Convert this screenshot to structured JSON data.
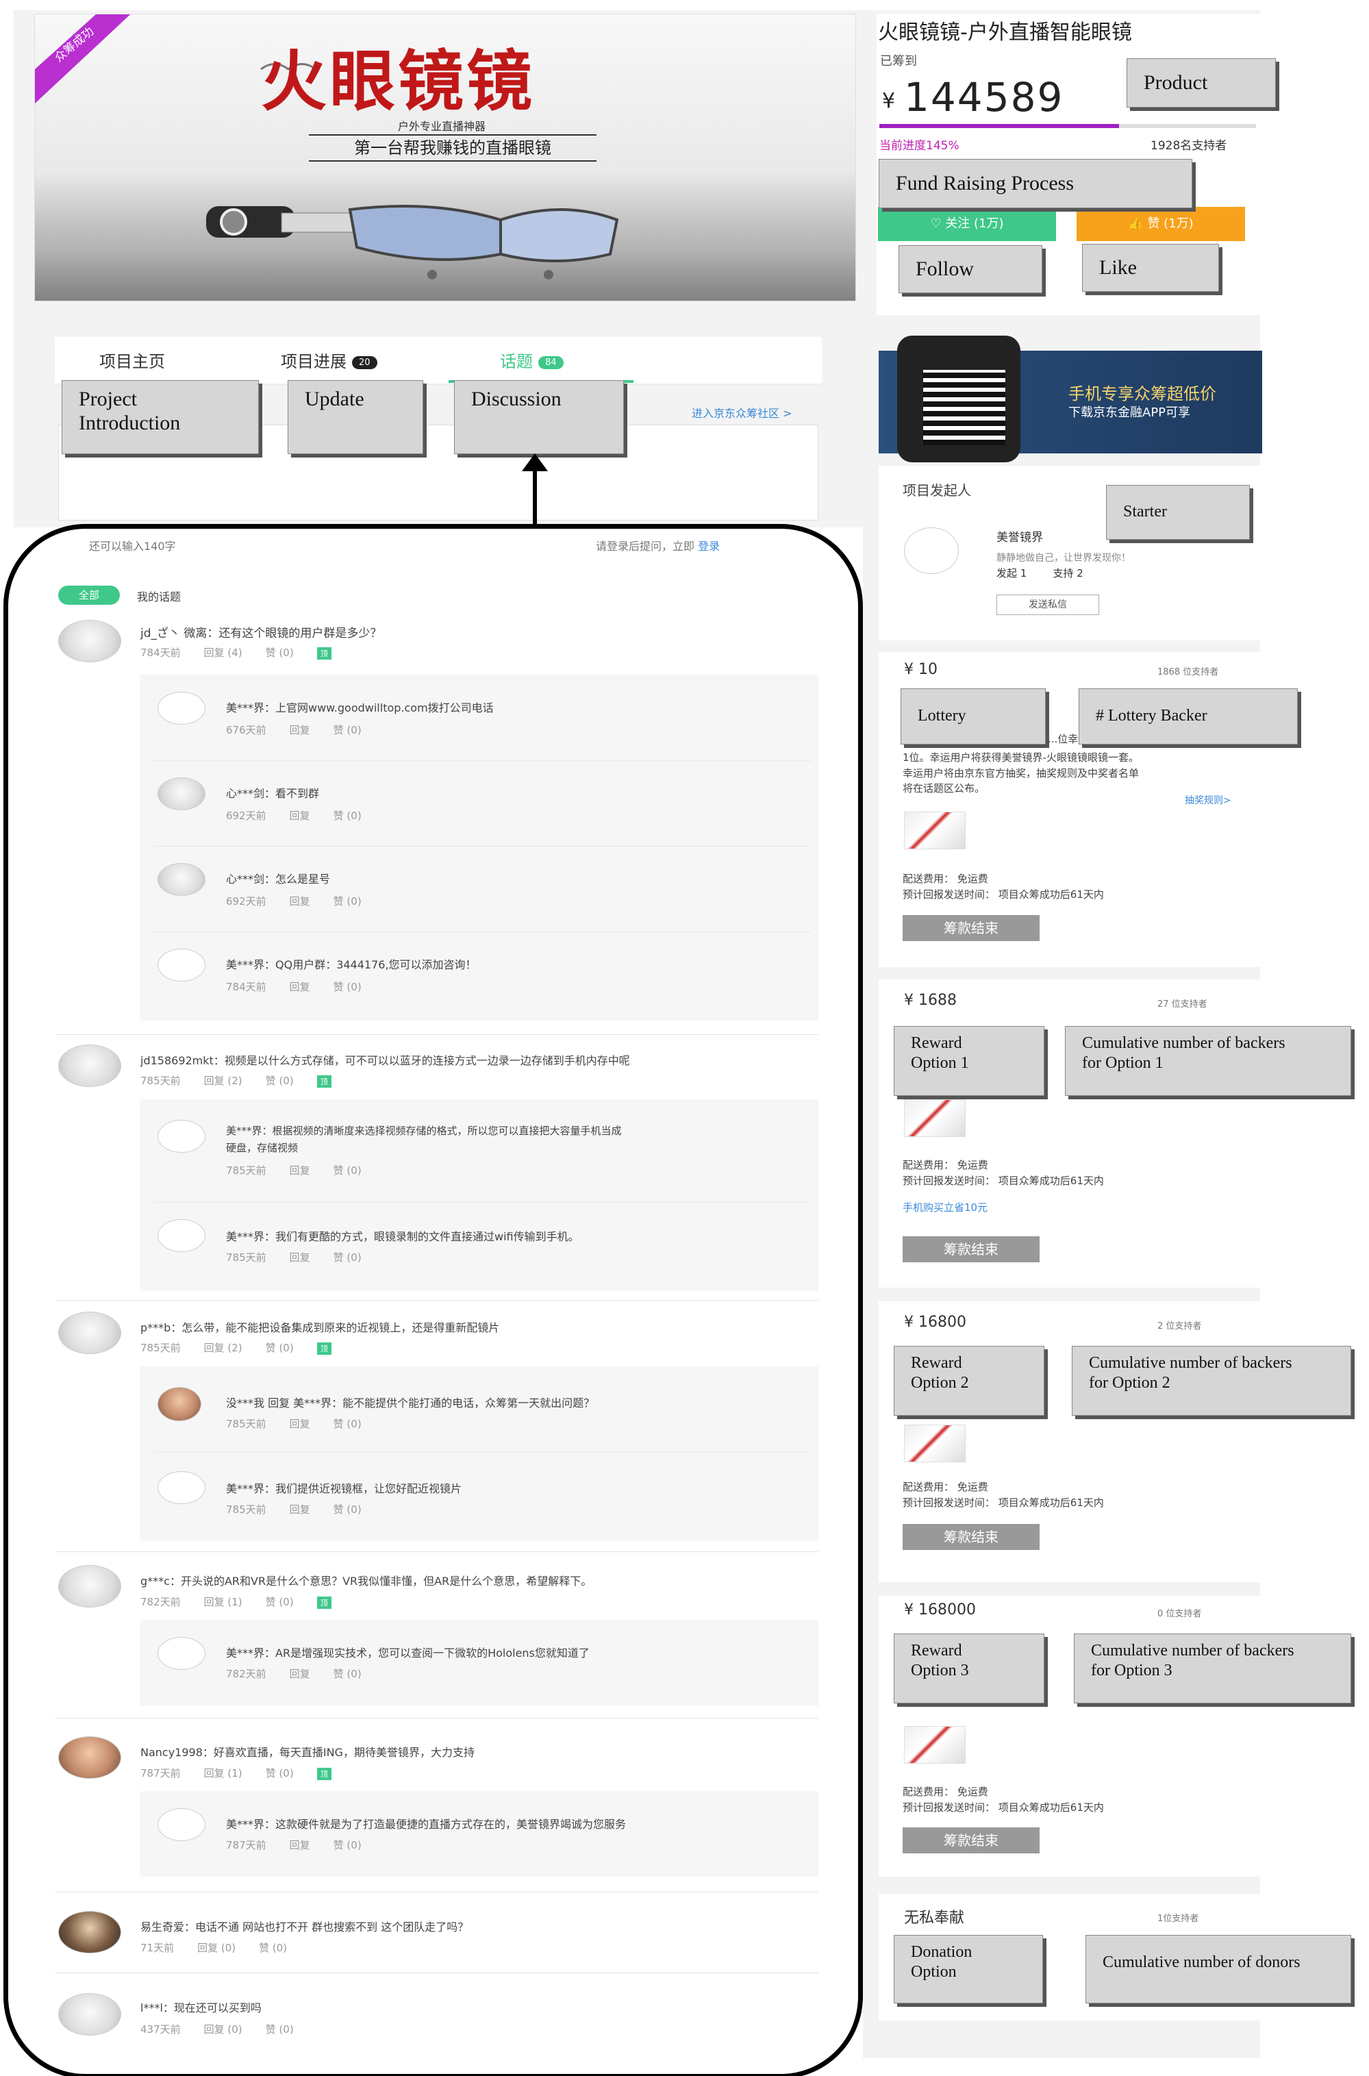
{
  "hero": {
    "ribbon": "众筹成功",
    "title": "火眼镜镜",
    "subtitle": "户外专业直播神器",
    "tagline": "第一台帮我赚钱的直播眼镜"
  },
  "product": {
    "title": "火眼镜镜-户外直播智能眼镜",
    "raised_label": "已筹到",
    "currency": "¥",
    "amount": "144589",
    "progress_label": "当前进度145%",
    "progress_percent": 145,
    "supporters": "1928名支持者",
    "follow_label": "关注 (1万)",
    "like_label": "赞 (1万)"
  },
  "annotations": {
    "product": "Product",
    "fund": "Fund Raising Process",
    "follow": "Follow",
    "like": "Like",
    "project": "Project\nIntroduction",
    "update": "Update",
    "discussion": "Discussion",
    "starter": "Starter",
    "lottery": "Lottery",
    "lottery_backer": "# Lottery Backer",
    "reward1": "Reward\nOption 1",
    "reward1_count": "Cumulative number of backers\nfor Option 1",
    "reward2": "Reward\nOption 2",
    "reward2_count": "Cumulative number of backers\nfor Option 2",
    "reward3": "Reward\nOption 3",
    "reward3_count": "Cumulative number of backers\nfor Option 3",
    "donation": "Donation\nOption",
    "donation_count": "Cumulative number of donors"
  },
  "tabs": {
    "home": "项目主页",
    "progress": "项目进展",
    "progress_count": "20",
    "topics": "话题",
    "topics_count": "84",
    "community": "进入京东众筹社区 >"
  },
  "input": {
    "remaining": "还可以输入140字",
    "login_prompt": "请登录后提问，立即",
    "login_link": "登录"
  },
  "filters": {
    "all": "全部",
    "mine": "我的话题"
  },
  "feed": [
    {
      "text": "jd_ざ丶 微离：还有这个眼镜的用户群是多少？",
      "days": "784天前",
      "reply": "回复 (4)",
      "like": "赞 (0)",
      "hot": "顶"
    },
    {
      "text": "美***界：上官网www.goodwilltop.com拨打公司电话",
      "days": "676天前",
      "reply": "回复",
      "like": "赞 (0)"
    },
    {
      "text": "心***剑：看不到群",
      "days": "692天前",
      "reply": "回复",
      "like": "赞 (0)"
    },
    {
      "text": "心***剑：怎么是星号",
      "days": "692天前",
      "reply": "回复",
      "like": "赞 (0)"
    },
    {
      "text": "美***界：QQ用户群：3444176,您可以添加咨询！",
      "days": "784天前",
      "reply": "回复",
      "like": "赞 (0)"
    },
    {
      "text": "jd158692mkt：视频是以什么方式存储，可不可以以蓝牙的连接方式一边录一边存储到手机内存中呢",
      "days": "785天前",
      "reply": "回复 (2)",
      "like": "赞 (0)",
      "hot": "顶"
    },
    {
      "text": "美***界：根据视频的清晰度来选择视频存储的格式，所以您可以直接把大容量手机当成",
      "text2": "硬盘，存储视频",
      "days": "785天前",
      "reply": "回复",
      "like": "赞 (0)"
    },
    {
      "text": "美***界：我们有更酷的方式，眼镜录制的文件直接通过wifi传输到手机。",
      "days": "785天前",
      "reply": "回复",
      "like": "赞 (0)"
    },
    {
      "text": "p***b：怎么带，能不能把设备集成到原来的近视镜上，还是得重新配镜片",
      "days": "785天前",
      "reply": "回复 (2)",
      "like": "赞 (0)",
      "hot": "顶"
    },
    {
      "text": "没***我 回复 美***界：能不能提供个能打通的电话，众筹第一天就出问题？",
      "days": "785天前",
      "reply": "回复",
      "like": "赞 (0)"
    },
    {
      "text": "美***界：我们提供近视镜框，让您好配近视镜片",
      "days": "785天前",
      "reply": "回复",
      "like": "赞 (0)"
    },
    {
      "text": "g***c：开头说的AR和VR是什么个意思？VR我似懂非懂，但AR是什么个意思，希望解释下。",
      "days": "782天前",
      "reply": "回复 (1)",
      "like": "赞 (0)",
      "hot": "顶"
    },
    {
      "text": "美***界：AR是增强现实技术，您可以查阅一下微软的Hololens您就知道了",
      "days": "782天前",
      "reply": "回复",
      "like": "赞 (0)"
    },
    {
      "text": "Nancy1998：好喜欢直播，每天直播ING，期待美誉镜界，大力支持",
      "days": "787天前",
      "reply": "回复 (1)",
      "like": "赞 (0)",
      "hot": "顶"
    },
    {
      "text": "美***界：这款硬件就是为了打造最便捷的直播方式存在的，美誉镜界竭诚为您服务",
      "days": "787天前",
      "reply": "回复",
      "like": "赞 (0)"
    },
    {
      "text": "易生奇爱：电话不通 网站也打不开 群也搜索不到 这个团队走了吗？",
      "days": "71天前",
      "reply": "回复 (0)",
      "like": "赞 (0)"
    },
    {
      "text": "l***l：现在还可以买到吗",
      "days": "437天前",
      "reply": "回复 (0)",
      "like": "赞 (0)"
    }
  ],
  "app_banner": {
    "line1": "手机专享众筹超低价",
    "line2": "下载京东金融APP可享"
  },
  "starter": {
    "title": "项目发起人",
    "name": "美誉镜界",
    "desc": "静静地做自己，让世界发现你！",
    "launched": "发起  1",
    "supported": "支持  2",
    "message": "发送私信"
  },
  "rewards": [
    {
      "price": "¥ 10",
      "count": "1868 位支持者",
      "line1": "...位幸",
      "line2": "1位。幸运用户将获得美誉镜界-火眼镜镜眼镜一套。",
      "line3": "幸运用户将由京东官方抽奖，抽奖规则及中奖者名单",
      "line4": "将在话题区公布。",
      "rule": "抽奖规则>",
      "ship": "配送费用： 免运费",
      "time": "预计回报发送时间： 项目众筹成功后61天内",
      "days": "61",
      "button": "筹款结束"
    },
    {
      "price": "¥ 1688",
      "count": "27 位支持者",
      "ship": "配送费用： 免运费",
      "time": "预计回报发送时间： 项目众筹成功后61天内",
      "days": "61",
      "extra": "手机购买立省10元",
      "button": "筹款结束"
    },
    {
      "price": "¥ 16800",
      "count": "2 位支持者",
      "ship": "配送费用： 免运费",
      "time": "预计回报发送时间： 项目众筹成功后61天内",
      "days": "61",
      "button": "筹款结束"
    },
    {
      "price": "¥ 168000",
      "count": "0 位支持者",
      "ship": "配送费用： 免运费",
      "time": "预计回报发送时间： 项目众筹成功后61天内",
      "days": "61",
      "button": "筹款结束"
    },
    {
      "price": "无私奉献",
      "count": "1位支持者"
    }
  ],
  "colors": {
    "green": "#3fc88a",
    "orange": "#f7a21a",
    "purple": "#a020c0",
    "red": "#c01818"
  }
}
